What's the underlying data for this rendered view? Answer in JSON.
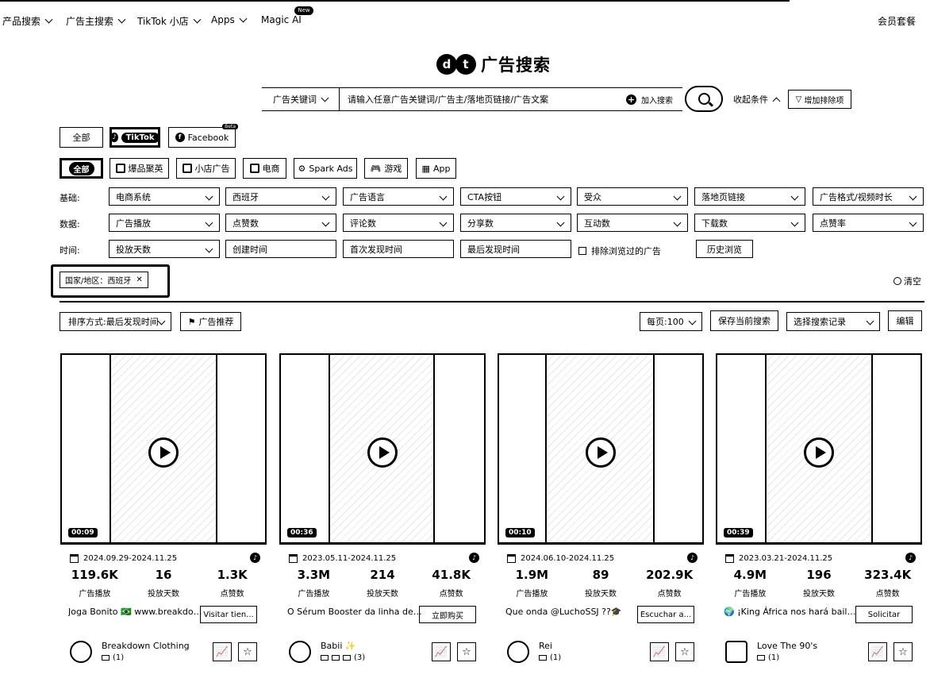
{
  "nav": {
    "items": [
      "产品搜索",
      "广告主搜索",
      "TikTok 小店",
      "Apps",
      "Magic AI"
    ],
    "new_badge": "New",
    "member": "会员套餐"
  },
  "brand": {
    "logo": "dt",
    "title": "广告搜索"
  },
  "search": {
    "type_label": "广告关键词",
    "placeholder": "请输入任意广告关键词/广告主/落地页链接/广告文案",
    "add_label": "加入搜索",
    "collapse_label": "收起条件",
    "add_filter_label": "增加排除项"
  },
  "platforms": {
    "all": "全部",
    "tiktok": "TikTok",
    "facebook": "Facebook",
    "beta": "Beta"
  },
  "categories": {
    "all": "全部",
    "items": [
      "爆品聚英",
      "小店广告",
      "电商",
      "Spark Ads",
      "游戏",
      "App"
    ]
  },
  "filters": {
    "basic_label": "基础:",
    "basic": [
      "电商系统",
      "西班牙",
      "广告语言",
      "CTA按钮",
      "受众",
      "落地页链接",
      "广告格式/视频时长"
    ],
    "data_label": "数据:",
    "data": [
      "广告播放",
      "点赞数",
      "评论数",
      "分享数",
      "互动数",
      "下载数",
      "点赞率"
    ],
    "time_label": "时间:",
    "time_dropdown": "投放天数",
    "time_fields": [
      "创建时间",
      "首次发现时间",
      "最后发现时间"
    ],
    "exclude_label": "排除浏览过的广告",
    "history_label": "历史浏览"
  },
  "selected_tag": "国家/地区：西班牙",
  "clear_label": "清空",
  "toolbar": {
    "sort": "排序方式:最后发现时间",
    "recommend": "广告推荐",
    "per_page": "每页:100",
    "save": "保存当前搜索",
    "select_record": "选择搜索记录",
    "edit": "编辑"
  },
  "cards": [
    {
      "duration": "00:09",
      "dates": "2024.09.29-2024.11.25",
      "stats": [
        {
          "v": "119.6K",
          "l": "广告播放"
        },
        {
          "v": "16",
          "l": "投放天数"
        },
        {
          "v": "1.3K",
          "l": "点赞数"
        }
      ],
      "desc": "Joga Bonito 🇧🇷 www.breakdown...",
      "cta": "Visitar tien...",
      "advertiser": "Breakdown Clothing",
      "count": "(1)"
    },
    {
      "duration": "00:36",
      "dates": "2023.05.11-2024.11.25",
      "stats": [
        {
          "v": "3.3M",
          "l": "广告播放"
        },
        {
          "v": "214",
          "l": "投放天数"
        },
        {
          "v": "41.8K",
          "l": "点赞数"
        }
      ],
      "desc": "O Sérum Booster da linha de cuid...",
      "cta": "立即购买",
      "advertiser": "Babii ✨",
      "count": "(3)"
    },
    {
      "duration": "00:10",
      "dates": "2024.06.10-2024.11.25",
      "stats": [
        {
          "v": "1.9M",
          "l": "广告播放"
        },
        {
          "v": "89",
          "l": "投放天数"
        },
        {
          "v": "202.9K",
          "l": "点赞数"
        }
      ],
      "desc": "Que onda @LuchoSSJ ??🎓",
      "cta": "Escuchar a...",
      "advertiser": "Rei",
      "count": "(1)"
    },
    {
      "duration": "00:39",
      "dates": "2023.03.21-2024.11.25",
      "stats": [
        {
          "v": "4.9M",
          "l": "广告播放"
        },
        {
          "v": "196",
          "l": "投放天数"
        },
        {
          "v": "323.4K",
          "l": "点赞数"
        }
      ],
      "desc": "🌍 ¡King África nos hará bailar co...",
      "cta": "Solicitar",
      "advertiser": "Love The 90's",
      "count": "(1)"
    }
  ]
}
